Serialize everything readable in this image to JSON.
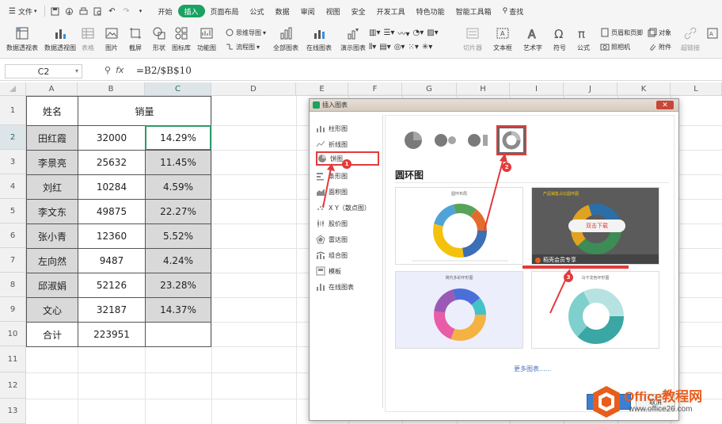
{
  "menubar": {
    "file_label": "文件",
    "tabs": [
      "开始",
      "插入",
      "页面布局",
      "公式",
      "数据",
      "审阅",
      "视图",
      "安全",
      "开发工具",
      "特色功能",
      "智能工具箱"
    ],
    "active_tab_index": 1,
    "search_label": "查找"
  },
  "ribbon": {
    "pivot_table": "数据透视表",
    "pivot_chart": "数据透视图",
    "table": "表格",
    "picture": "图片",
    "screenshot": "截屏",
    "shapes": "形状",
    "icon_library": "图标库",
    "function_chart": "功能图",
    "mindmap": "思维导图",
    "flowchart": "流程图",
    "all_charts": "全部图表",
    "online_charts": "在线图表",
    "demo_charts": "演示图表",
    "slicer": "切片器",
    "textbox": "文本框",
    "wordart": "艺术字",
    "symbol": "符号",
    "formula": "公式",
    "header_footer": "页眉和页脚",
    "object": "对象",
    "camera": "照相机",
    "attachment": "附件",
    "hyperlink": "超链接"
  },
  "formula_bar": {
    "name_box": "C2",
    "fx_label": "fx",
    "formula": "=B2/$B$10"
  },
  "grid": {
    "columns": [
      "A",
      "B",
      "C",
      "D",
      "E",
      "F",
      "G",
      "H",
      "I",
      "J",
      "K",
      "L"
    ],
    "rows": [
      "1",
      "2",
      "3",
      "4",
      "5",
      "6",
      "7",
      "8",
      "9",
      "10",
      "11",
      "12",
      "13"
    ],
    "header": {
      "name": "姓名",
      "sales": "销量"
    },
    "records": [
      {
        "name": "田红霞",
        "sales": "32000",
        "pct": "14.29%"
      },
      {
        "name": "李景亮",
        "sales": "25632",
        "pct": "11.45%"
      },
      {
        "name": "刘红",
        "sales": "10284",
        "pct": "4.59%"
      },
      {
        "name": "李文东",
        "sales": "49875",
        "pct": "22.27%"
      },
      {
        "name": "张小青",
        "sales": "12360",
        "pct": "5.52%"
      },
      {
        "name": "左向然",
        "sales": "9487",
        "pct": "4.24%"
      },
      {
        "name": "邱淑娟",
        "sales": "52126",
        "pct": "23.28%"
      },
      {
        "name": "文心",
        "sales": "32187",
        "pct": "14.37%"
      }
    ],
    "total": {
      "label": "合计",
      "value": "223951"
    }
  },
  "dialog": {
    "title": "插入图表",
    "categories": [
      "柱形图",
      "折线图",
      "饼图",
      "条形图",
      "面积图",
      "X Y（散点图）",
      "股价图",
      "雷达图",
      "组合图",
      "模板",
      "在线图表"
    ],
    "active_category_index": 2,
    "section_title": "圆环图",
    "thumb_download": "双击下载",
    "thumb_vip": "稻壳会员专享",
    "thumb1_title": "圆环布局",
    "thumb2_title": "产品销售占比圆环图",
    "thumb3_title": "简约多彩环形图",
    "thumb4_title": "马卡龙色环形图",
    "more_charts": "更多图表......",
    "cancel_label": "取消"
  },
  "annotations": [
    "1",
    "2",
    "3"
  ],
  "watermark": {
    "brand": "Office教程网",
    "url": "www.office26.com"
  },
  "colors": {
    "accent_green": "#1aa261",
    "annotation_red": "#e23b3b",
    "shade_gray": "#d9d9d9",
    "watermark_orange": "#e85d1c"
  }
}
